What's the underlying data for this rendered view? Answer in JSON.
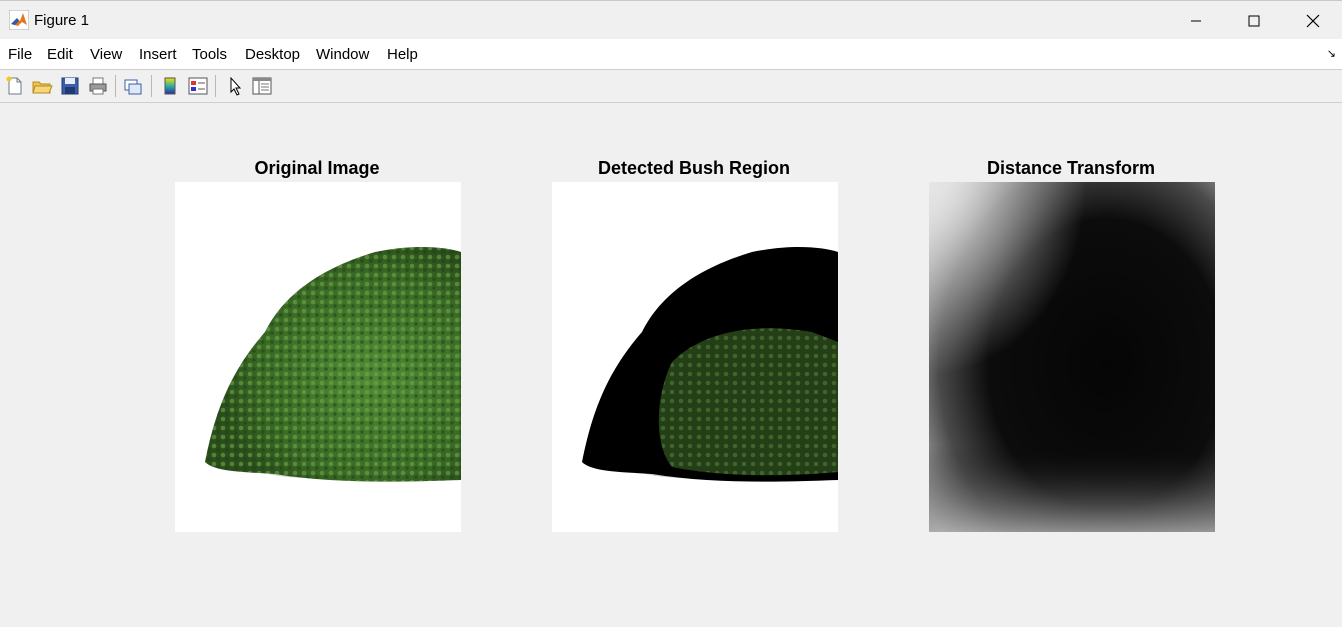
{
  "window": {
    "title": "Figure 1"
  },
  "menu": {
    "items": [
      "File",
      "Edit",
      "View",
      "Insert",
      "Tools",
      "Desktop",
      "Window",
      "Help"
    ],
    "dock_arrow": "↘"
  },
  "toolbar": {
    "icons": [
      "new-figure-icon",
      "open-file-icon",
      "save-icon",
      "print-icon",
      "link-plot-icon",
      "insert-colorbar-icon",
      "insert-legend-icon",
      "edit-plot-icon",
      "property-inspector-icon"
    ]
  },
  "figure": {
    "panels": [
      {
        "title": "Original Image"
      },
      {
        "title": "Detected Bush Region"
      },
      {
        "title": "Distance Transform"
      }
    ]
  },
  "colors": {
    "bush": "#3f6f2a",
    "bush_dark": "#274a1a",
    "mask": "#000000",
    "matlab_orange": "#e8741c"
  }
}
